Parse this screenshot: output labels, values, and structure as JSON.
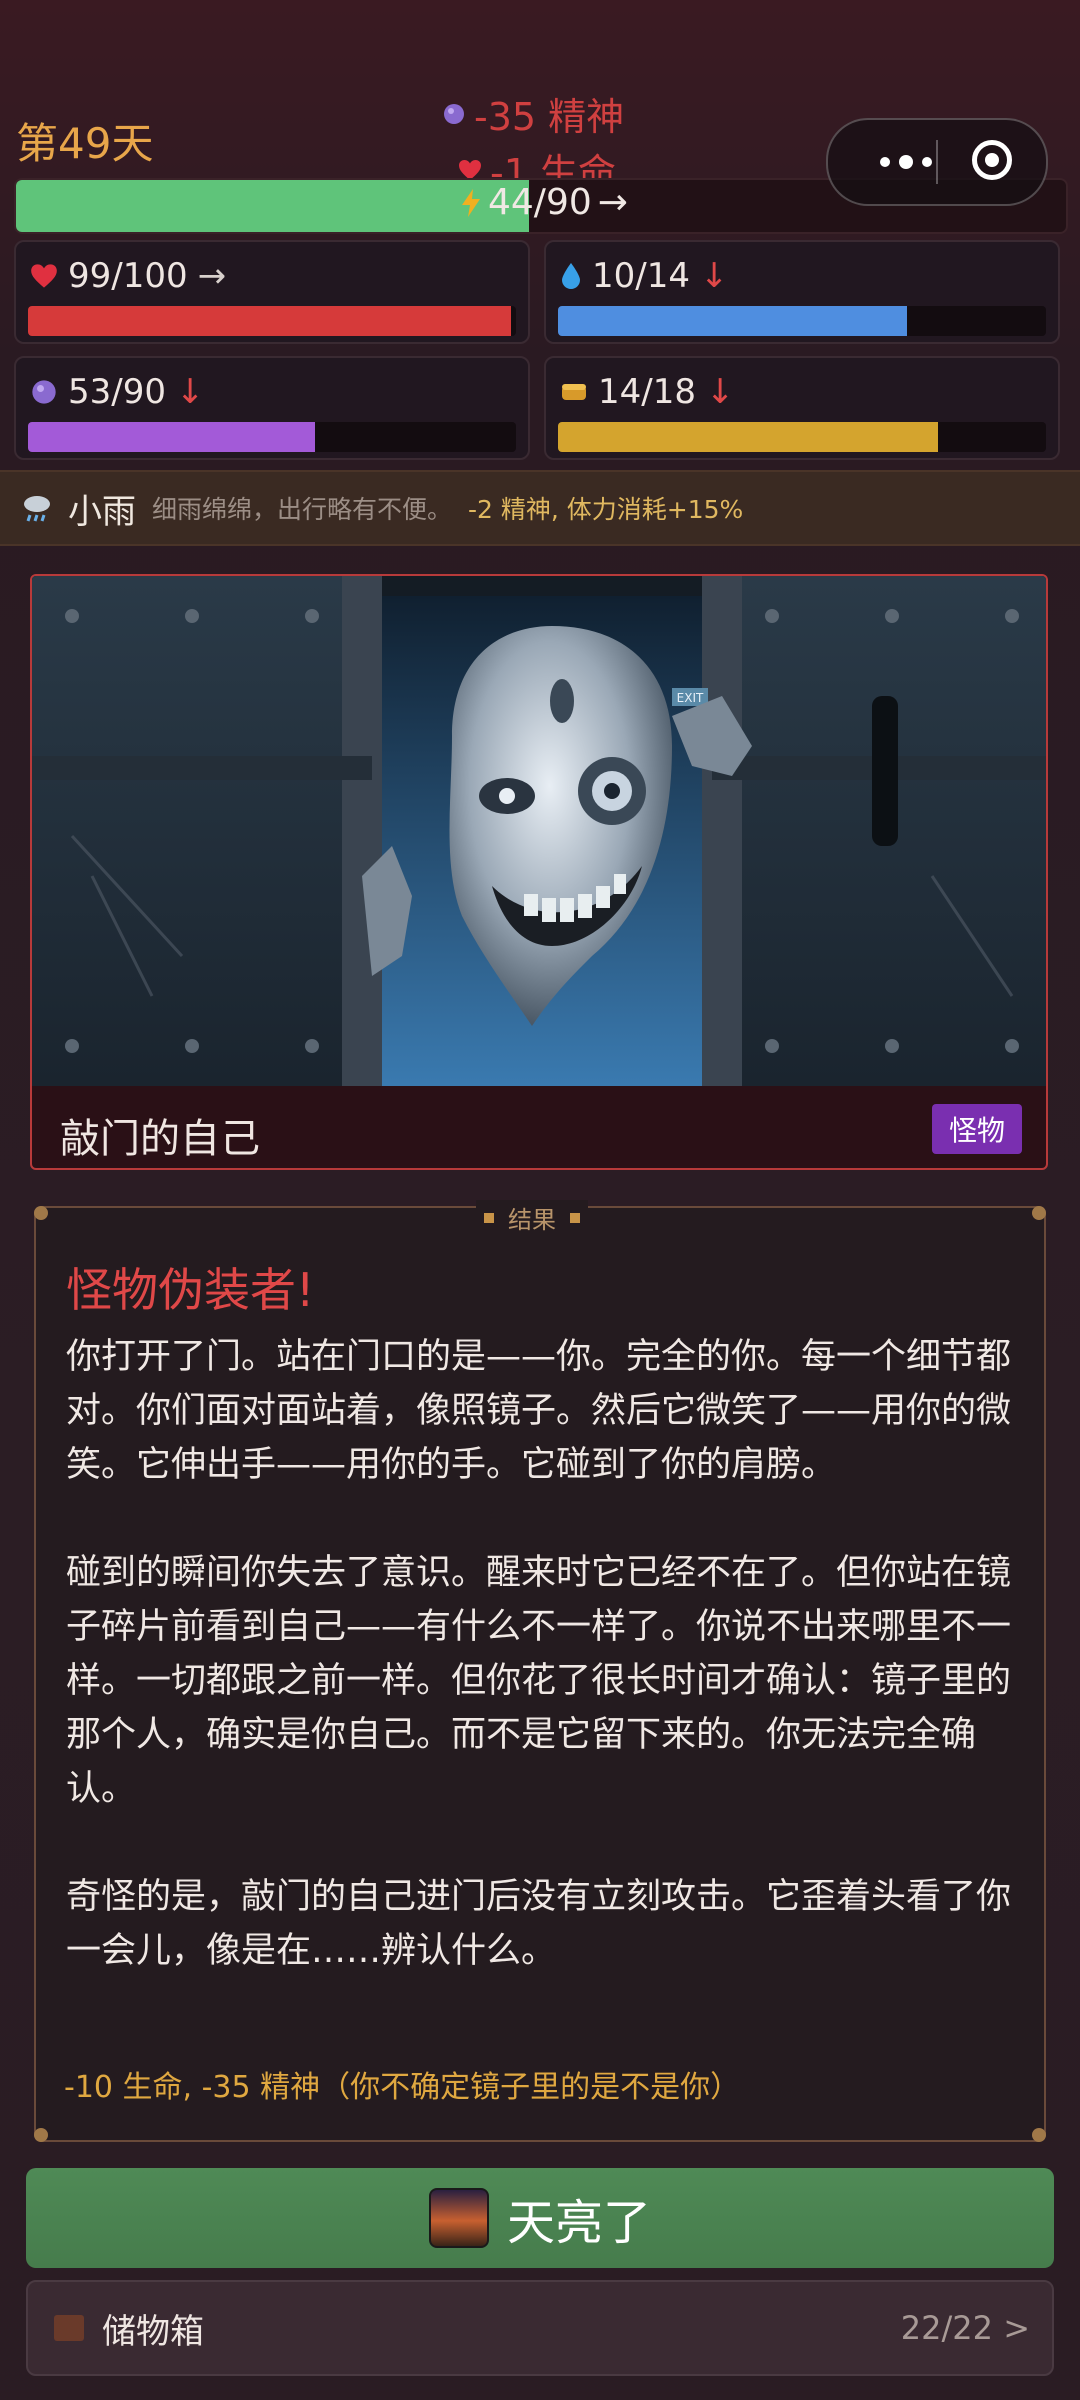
{
  "header": {
    "day": "第49天",
    "float_effects": [
      {
        "text": "-35 精神",
        "icon": "brain-orb-icon"
      },
      {
        "text": "-1 生命",
        "icon": "heart-icon"
      }
    ],
    "energy": {
      "label": "44/90",
      "trend": "→",
      "value": 44,
      "max": 90,
      "color": "#5fc47a"
    }
  },
  "stats": [
    {
      "name": "health",
      "icon": "heart-icon",
      "label": "99/100",
      "trend": "→",
      "value": 99,
      "max": 100,
      "color": "#d63a3a"
    },
    {
      "name": "water",
      "icon": "water-drop-icon",
      "label": "10/14",
      "trend": "↓",
      "value": 10,
      "max": 14,
      "color": "#4f8ee0"
    },
    {
      "name": "sanity",
      "icon": "brain-orb-icon",
      "label": "53/90",
      "trend": "↓",
      "value": 53,
      "max": 90,
      "color": "#a35ad8"
    },
    {
      "name": "food",
      "icon": "bread-icon",
      "label": "14/18",
      "trend": "↓",
      "value": 14,
      "max": 18,
      "color": "#d4a42e"
    }
  ],
  "weather": {
    "icon": "rain-cloud-icon",
    "name": "小雨",
    "description": "细雨绵绵，出行略有不便。",
    "effect": "-2 精神, 体力消耗+15%"
  },
  "event": {
    "title": "敲门的自己",
    "tag": "怪物",
    "exit_sign": "EXIT"
  },
  "result": {
    "header": "结果",
    "title": "怪物伪装者!",
    "paragraphs": [
      "你打开了门。站在门口的是——你。完全的你。每一个细节都对。你们面对面站着，像照镜子。然后它微笑了——用你的微笑。它伸出手——用你的手。它碰到了你的肩膀。",
      "碰到的瞬间你失去了意识。醒来时它已经不在了。但你站在镜子碎片前看到自己——有什么不一样了。你说不出来哪里不一样。一切都跟之前一样。但你花了很长时间才确认：镜子里的那个人，确实是你自己。而不是它留下来的。你无法完全确认。",
      "奇怪的是，敲门的自己进门后没有立刻攻击。它歪着头看了你一会儿，像是在……辨认什么。"
    ],
    "effect": "-10 生命, -35 精神（你不确定镜子里的是不是你）"
  },
  "actions": {
    "dawn_label": "天亮了",
    "dawn_icon": "sunrise-icon",
    "storage_label": "储物箱",
    "storage_icon": "chest-icon",
    "storage_count": "22/22 >"
  }
}
